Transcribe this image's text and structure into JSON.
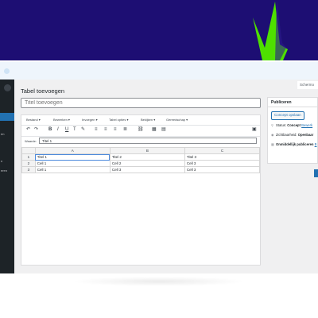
{
  "colors": {
    "hero": "#1d0e73",
    "accent_green": "#4ee000",
    "wp_blue": "#2271b1",
    "sidebar": "#1d2327"
  },
  "screen_options": "Schermo",
  "sidebar": {
    "items": [
      {
        "label": "en"
      },
      {
        "label": "n"
      },
      {
        "label": "eren"
      }
    ]
  },
  "page": {
    "title": "Tabel toevoegen",
    "title_placeholder": "Titel toevoegen"
  },
  "editor": {
    "menu": [
      "Bestand",
      "Bewerken",
      "Invoegen",
      "Tabel opties",
      "Bekijken",
      "Gereedschap"
    ],
    "toolbar_icons": [
      "undo-icon",
      "redo-icon",
      "bold-icon",
      "italic-icon",
      "underline-icon",
      "strikethrough-icon",
      "text-color-icon",
      "align-left-icon",
      "align-center-icon",
      "align-right-icon",
      "justify-icon",
      "link-icon",
      "table-icon",
      "table-props-icon",
      "trash-icon"
    ],
    "cell_label": "Waarde:",
    "cell_value": "Titel 1",
    "table": {
      "columns": [
        "A",
        "B",
        "C"
      ],
      "rows": [
        {
          "n": "1",
          "cells": [
            "Titel 1",
            "Titel 2",
            "Titel 3"
          ]
        },
        {
          "n": "2",
          "cells": [
            "Cell 1",
            "Cell 2",
            "Cell 3"
          ]
        },
        {
          "n": "3",
          "cells": [
            "Cell 1",
            "Cell 3",
            "Cell 3"
          ]
        }
      ]
    }
  },
  "publish": {
    "heading": "Publiceren",
    "draft_button": "Concept opslaan",
    "status_label": "Status:",
    "status_value": "Concept",
    "status_link": "Bewerk",
    "visibility_label": "Zichtbaarheid:",
    "visibility_value": "Openbaar",
    "publish_label": "Onmiddellijk publiceren",
    "publish_link": "B"
  }
}
